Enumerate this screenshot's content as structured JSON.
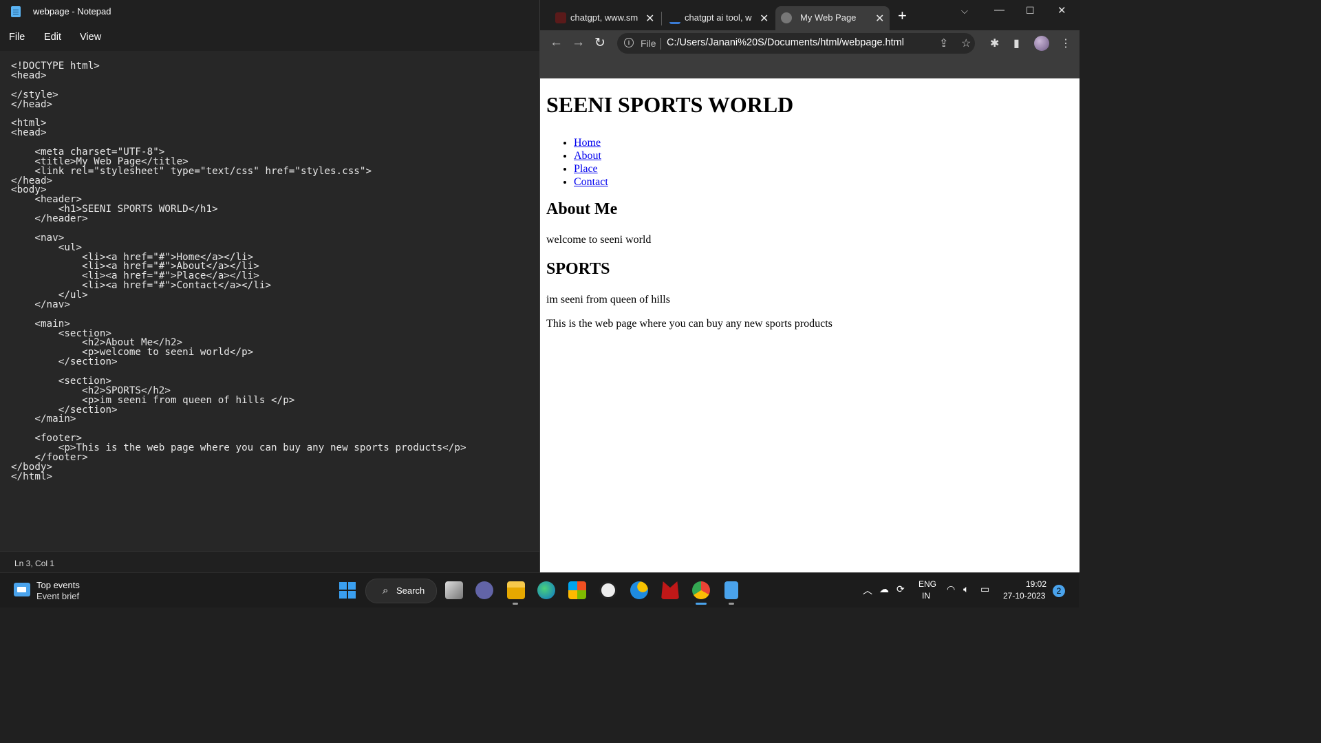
{
  "notepad": {
    "title": "webpage - Notepad",
    "menu": [
      "File",
      "Edit",
      "View"
    ],
    "code": "<!DOCTYPE html>\n<head>\n\n</style>\n</head>\n\n<html>\n<head>\n\n    <meta charset=\"UTF-8\">\n    <title>My Web Page</title>\n    <link rel=\"stylesheet\" type=\"text/css\" href=\"styles.css\">\n</head>\n<body>\n    <header>\n        <h1>SEENI SPORTS WORLD</h1>\n    </header>\n\n    <nav>\n        <ul>\n            <li><a href=\"#\">Home</a></li>\n            <li><a href=\"#\">About</a></li>\n            <li><a href=\"#\">Place</a></li>\n            <li><a href=\"#\">Contact</a></li>\n        </ul>\n    </nav>\n\n    <main>\n        <section>\n            <h2>About Me</h2>\n            <p>welcome to seeni world</p>\n        </section>\n\n        <section>\n            <h2>SPORTS</h2>\n            <p>im seeni from queen of hills </p>\n        </section>\n    </main>\n\n    <footer>\n        <p>This is the web page where you can buy any new sports products</p>\n    </footer>\n</body>\n</html>",
    "status": "Ln 3, Col 1"
  },
  "browser": {
    "tabs": [
      {
        "label": "chatgpt, www.sma",
        "favicon_color": "#5a1a1a"
      },
      {
        "label": "chatgpt ai tool, w",
        "favicon_color": "#3a7bd5"
      },
      {
        "label": "My Web Page",
        "favicon_color": "#888888"
      }
    ],
    "address": {
      "scheme_label": "File",
      "url": "C:/Users/Janani%20S/Documents/html/webpage.html"
    },
    "page": {
      "h1": "SEENI SPORTS WORLD",
      "nav": [
        "Home",
        "About",
        "Place",
        "Contact"
      ],
      "about_heading": "About Me",
      "about_text": "welcome to seeni world",
      "sports_heading": "SPORTS",
      "sports_text": "im seeni from queen of hills",
      "footer_text": "This is the web page where you can buy any new sports products"
    }
  },
  "taskbar": {
    "widget_title": "Top events",
    "widget_subtitle": "Event brief",
    "search_label": "Search",
    "lang_line1": "ENG",
    "lang_line2": "IN",
    "time": "19:02",
    "date": "27-10-2023",
    "notification_count": "2"
  },
  "colors": {
    "link": "#0000ee",
    "accent": "#4aa3ec",
    "mcafee": "#c01818"
  }
}
